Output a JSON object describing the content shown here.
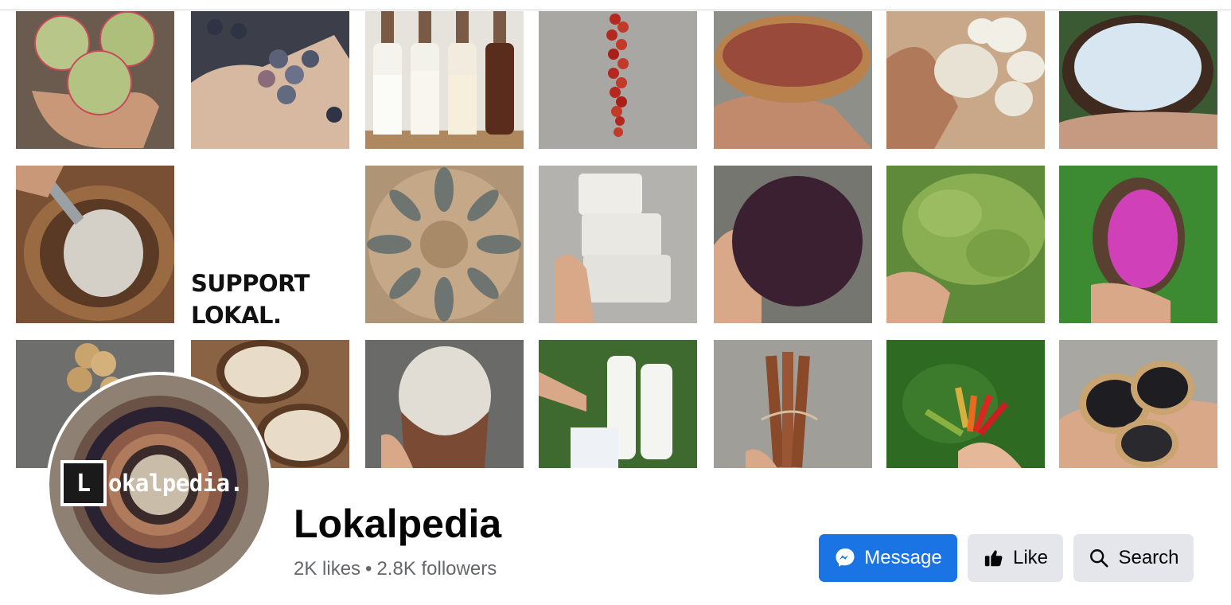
{
  "cover": {
    "support_line1": "SUPPORT",
    "support_line2": "LOKAL."
  },
  "profile": {
    "logo_letter": "L",
    "logo_text": "okalpedia.",
    "name": "Lokalpedia",
    "likes": "2K likes",
    "separator": "•",
    "followers": "2.8K followers"
  },
  "actions": {
    "message_label": "Message",
    "like_label": "Like",
    "search_label": "Search"
  },
  "colors": {
    "primary": "#1b74e4",
    "secondary_bg": "#e4e6eb",
    "muted_text": "#65676b"
  },
  "icons": {
    "message": "messenger-icon",
    "like": "thumbs-up-icon",
    "search": "search-icon"
  }
}
